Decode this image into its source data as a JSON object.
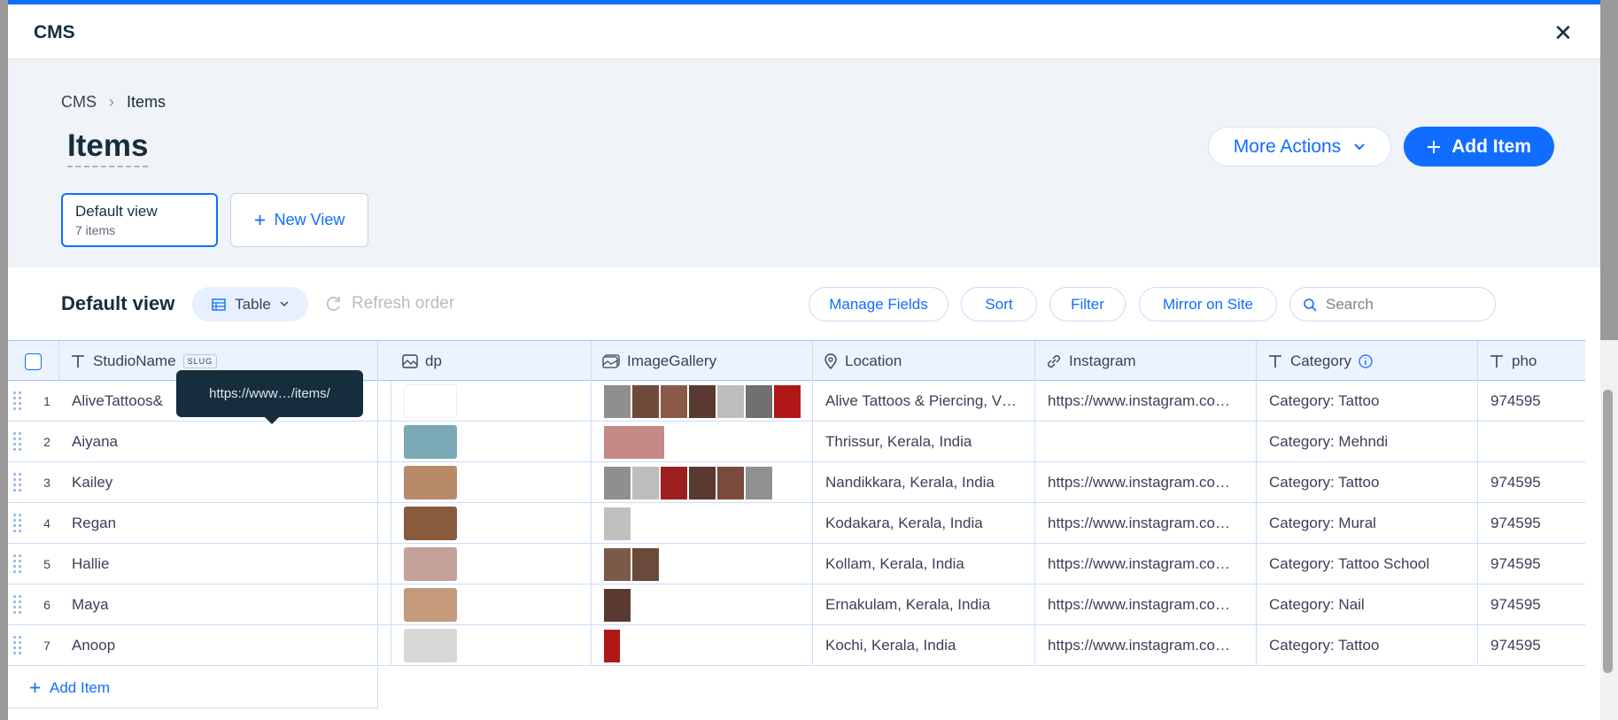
{
  "window": {
    "title": "CMS",
    "close_glyph": "✕"
  },
  "breadcrumb": {
    "root": "CMS",
    "current": "Items",
    "separator": "›"
  },
  "page": {
    "title": "Items"
  },
  "actions": {
    "more_actions": "More Actions",
    "add_item": "Add Item"
  },
  "views": {
    "default": {
      "name": "Default view",
      "count": "7 items"
    },
    "new_view": "New View"
  },
  "toolbar": {
    "title": "Default view",
    "layout": "Table",
    "refresh": "Refresh order",
    "manage_fields": "Manage Fields",
    "sort": "Sort",
    "filter": "Filter",
    "mirror": "Mirror on Site",
    "search_placeholder": "Search"
  },
  "columns": [
    {
      "label": "StudioName",
      "icon": "text-icon",
      "badge": "SLUG"
    },
    {
      "label": "dp",
      "icon": "image-icon"
    },
    {
      "label": "ImageGallery",
      "icon": "gallery-icon"
    },
    {
      "label": "Location",
      "icon": "location-icon"
    },
    {
      "label": "Instagram",
      "icon": "link-icon"
    },
    {
      "label": "Category",
      "icon": "text-icon"
    },
    {
      "label": "pho",
      "icon": "text-icon"
    }
  ],
  "rows": [
    {
      "num": "1",
      "name": "AliveTattoos&",
      "location": "Alive Tattoos & Piercing, V…",
      "instagram": "https://www.instagram.co…",
      "category": "Category: Tattoo",
      "phone": "974595",
      "dp_color": "#ffffff",
      "gallery": [
        "#8f8f8f",
        "#6f4a3a",
        "#8a5a48",
        "#5a3a30",
        "#bdbdbd",
        "#707070",
        "#b01818"
      ]
    },
    {
      "num": "2",
      "name": "Aiyana",
      "location": "Thrissur, Kerala, India",
      "instagram": "",
      "category": "Category: Mehndi",
      "phone": "",
      "dp_color": "#7aa8b4",
      "gallery": [
        "#c48a86"
      ]
    },
    {
      "num": "3",
      "name": "Kailey",
      "location": "Nandikkara, Kerala, India",
      "instagram": "https://www.instagram.co…",
      "category": "Category: Tattoo",
      "phone": "974595",
      "dp_color": "#b98a6a",
      "gallery": [
        "#8f8f8f",
        "#bdbdbd",
        "#9c2020",
        "#5a3a30",
        "#7a4a3c",
        "#909090"
      ]
    },
    {
      "num": "4",
      "name": "Regan",
      "location": "Kodakara, Kerala, India",
      "instagram": "https://www.instagram.co…",
      "category": "Category: Mural",
      "phone": "974595",
      "dp_color": "#8a5a3c",
      "gallery": [
        "#c0c0c0"
      ]
    },
    {
      "num": "5",
      "name": "Hallie",
      "location": "Kollam, Kerala, India",
      "instagram": "https://www.instagram.co…",
      "category": "Category: Tattoo School",
      "phone": "974595",
      "dp_color": "#c4a29a",
      "gallery": [
        "#7a5a48",
        "#6a4a3a"
      ]
    },
    {
      "num": "6",
      "name": "Maya",
      "location": "Ernakulam, Kerala, India",
      "instagram": "https://www.instagram.co…",
      "category": "Category: Nail",
      "phone": "974595",
      "dp_color": "#c49a7a",
      "gallery": [
        "#5a3a30"
      ]
    },
    {
      "num": "7",
      "name": "Anoop",
      "location": "Kochi, Kerala, India",
      "instagram": "https://www.instagram.co…",
      "category": "Category: Tattoo",
      "phone": "974595",
      "dp_color": "#d8d8d8",
      "gallery": [
        "#b01818"
      ]
    }
  ],
  "tooltip": {
    "text": "https://www…/items/"
  },
  "footer": {
    "add_item": "Add Item"
  },
  "colors": {
    "accent": "#116dff",
    "text": "#162d3d",
    "border": "#c9dcfb"
  }
}
